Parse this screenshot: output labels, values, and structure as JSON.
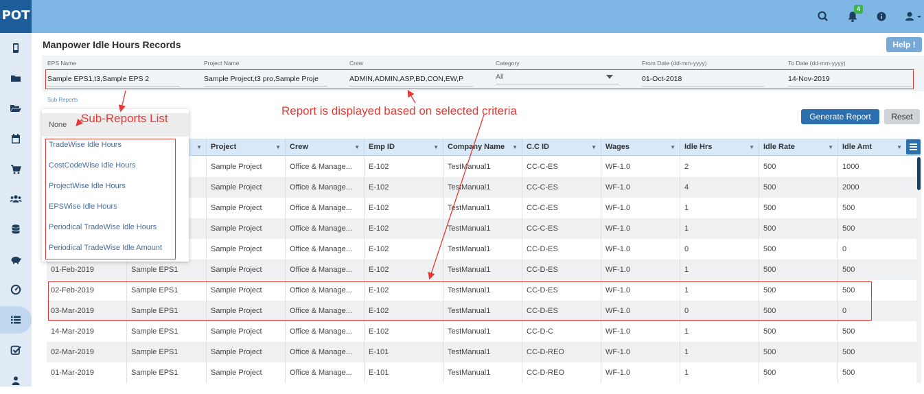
{
  "app": {
    "logo": "POT",
    "notification_count": "4"
  },
  "topbar_icons": [
    "search-icon",
    "bell-icon",
    "info-icon",
    "user-icon"
  ],
  "sidebar_icons": [
    "mobile-icon",
    "folder-icon",
    "folder-open-icon",
    "calendar-icon",
    "cart-icon",
    "users-icon",
    "database-icon",
    "piggy-bank-icon",
    "dashboard-icon",
    "list-icon",
    "check-square-icon",
    "user-icon"
  ],
  "page": {
    "title": "Manpower Idle Hours Records",
    "help": "Help !"
  },
  "filters": [
    {
      "label": "EPS Name",
      "value": "Sample EPS1,t3,Sample EPS 2"
    },
    {
      "label": "Project Name",
      "value": "Sample Project,t3 pro,Sample Proje"
    },
    {
      "label": "Crew",
      "value": "ADMIN,ADMIN,ASP,BD,CON,EW,P"
    },
    {
      "label": "Category",
      "value": "All"
    },
    {
      "label": "From Date (dd-mm-yyyy)",
      "value": "01-Oct-2018"
    },
    {
      "label": "To Date (dd-mm-yyyy)",
      "value": "14-Nov-2019"
    }
  ],
  "sub_reports": {
    "label": "Sub Reports",
    "selected": "None",
    "options": [
      "TradeWise Idle Hours",
      "CostCodeWise Idle Hours",
      "ProjectWise Idle Hours",
      "EPSWise Idle Hours",
      "Periodical TradeWise Idle Hours",
      "Periodical TradeWise Idle Amount"
    ]
  },
  "buttons": {
    "generate": "Generate Report",
    "reset": "Reset"
  },
  "table": {
    "columns": [
      "Project",
      "Crew",
      "Emp ID",
      "Company Name",
      "C.C ID",
      "Wages",
      "Idle Hrs",
      "Idle Rate",
      "Idle Amt"
    ],
    "rows": [
      [
        "",
        "",
        "Sample Project",
        "Office & Manage...",
        "E-102",
        "TestManual1",
        "CC-C-ES",
        "WF-1.0",
        "2",
        "500",
        "1000"
      ],
      [
        "",
        "",
        "Sample Project",
        "Office & Manage...",
        "E-102",
        "TestManual1",
        "CC-C-ES",
        "WF-1.0",
        "4",
        "500",
        "2000"
      ],
      [
        "",
        "",
        "Sample Project",
        "Office & Manage...",
        "E-102",
        "TestManual1",
        "CC-C-ES",
        "WF-1.0",
        "1",
        "500",
        "500"
      ],
      [
        "",
        "",
        "Sample Project",
        "Office & Manage...",
        "E-102",
        "TestManual1",
        "CC-C-ES",
        "WF-1.0",
        "1",
        "500",
        "500"
      ],
      [
        "",
        "",
        "Sample Project",
        "Office & Manage...",
        "E-102",
        "TestManual1",
        "CC-D-ES",
        "WF-1.0",
        "0",
        "500",
        "0"
      ],
      [
        "01-Feb-2019",
        "Sample EPS1",
        "Sample Project",
        "Office & Manage...",
        "E-102",
        "TestManual1",
        "CC-D-ES",
        "WF-1.0",
        "1",
        "500",
        "500"
      ],
      [
        "02-Feb-2019",
        "Sample EPS1",
        "Sample Project",
        "Office & Manage...",
        "E-102",
        "TestManual1",
        "CC-D-ES",
        "WF-1.0",
        "1",
        "500",
        "500"
      ],
      [
        "03-Mar-2019",
        "Sample EPS1",
        "Sample Project",
        "Office & Manage...",
        "E-102",
        "TestManual1",
        "CC-D-ES",
        "WF-1.0",
        "0",
        "500",
        "0"
      ],
      [
        "14-Mar-2019",
        "Sample EPS1",
        "Sample Project",
        "Office & Manage...",
        "E-102",
        "TestManual1",
        "CC-D-C",
        "WF-1.0",
        "1",
        "500",
        "500"
      ],
      [
        "02-Mar-2019",
        "Sample EPS1",
        "Sample Project",
        "Office & Manage...",
        "E-101",
        "TestManual1",
        "CC-D-REO",
        "WF-1.0",
        "1",
        "500",
        "500"
      ],
      [
        "01-Mar-2019",
        "Sample EPS1",
        "Sample Project",
        "Office & Manage...",
        "E-101",
        "TestManual1",
        "CC-D-REO",
        "WF-1.0",
        "1",
        "500",
        "500"
      ]
    ]
  },
  "annotations": {
    "sub_reports_list": "Sub-Reports List",
    "report_criteria": "Report is displayed based on selected criteria"
  },
  "colors": {
    "topbar": "#7eb6e6",
    "logo_bg": "#1c5d9a",
    "primary_button": "#2b6fae",
    "annotation": "#e53935",
    "header_row": "#d7e8f8"
  }
}
